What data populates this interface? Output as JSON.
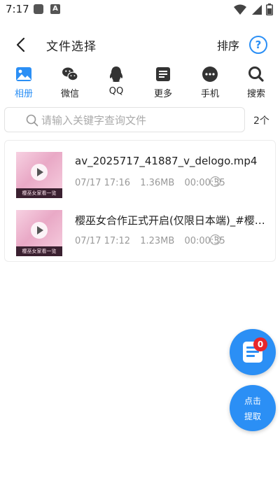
{
  "status_bar": {
    "time": "7:17",
    "app_letter": "A"
  },
  "header": {
    "title": "文件选择",
    "sort_label": "排序",
    "help_symbol": "?"
  },
  "tabs": [
    {
      "label": "相册",
      "icon": "gallery-icon",
      "active": true
    },
    {
      "label": "微信",
      "icon": "wechat-icon",
      "active": false
    },
    {
      "label": "QQ",
      "icon": "qq-icon",
      "active": false
    },
    {
      "label": "更多",
      "icon": "more-doc-icon",
      "active": false
    },
    {
      "label": "手机",
      "icon": "phone-dots-icon",
      "active": false
    },
    {
      "label": "搜索",
      "icon": "search-icon",
      "active": false
    }
  ],
  "search": {
    "placeholder": "请输入关键字查询文件",
    "value": ""
  },
  "result_count": "2个",
  "files": [
    {
      "name": "av_2025717_41887_v_delogo.mp4",
      "date": "07/17 17:16",
      "size": "1.36MB",
      "duration": "00:00:35",
      "thumb_caption": "樱巫女家看一览"
    },
    {
      "name": "樱巫女合作正式开启(仅限日本端)_#樱巫女",
      "date": "07/17 17:12",
      "size": "1.23MB",
      "duration": "00:00:35",
      "thumb_caption": "樱巫女家看一览"
    }
  ],
  "fab": {
    "badge_count": "0",
    "extract_line1": "点击",
    "extract_line2": "提取"
  },
  "colors": {
    "accent": "#2b8ff5",
    "badge": "#e8262b"
  }
}
